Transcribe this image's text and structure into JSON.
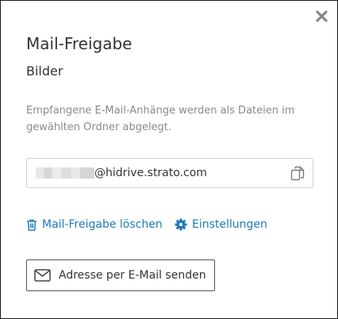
{
  "dialog": {
    "title": "Mail-Freigabe",
    "folder_name": "Bilder",
    "description": "Empfangene E-Mail-Anhänge werden als Dateien im gewählten Ordner abgelegt.",
    "close_icon": "close-icon"
  },
  "address": {
    "domain": "@hidrive.strato.com",
    "local_part_redacted": true,
    "copy_icon": "copy-icon"
  },
  "actions": {
    "delete_label": "Mail-Freigabe löschen",
    "delete_icon": "trash-icon",
    "settings_label": "Einstellungen",
    "settings_icon": "gear-icon",
    "send_label": "Adresse per E-Mail senden",
    "send_icon": "envelope-icon"
  },
  "colors": {
    "link": "#1f7ab8",
    "text": "#333333",
    "muted": "#8a8a8a",
    "border": "#d0d0d0"
  }
}
